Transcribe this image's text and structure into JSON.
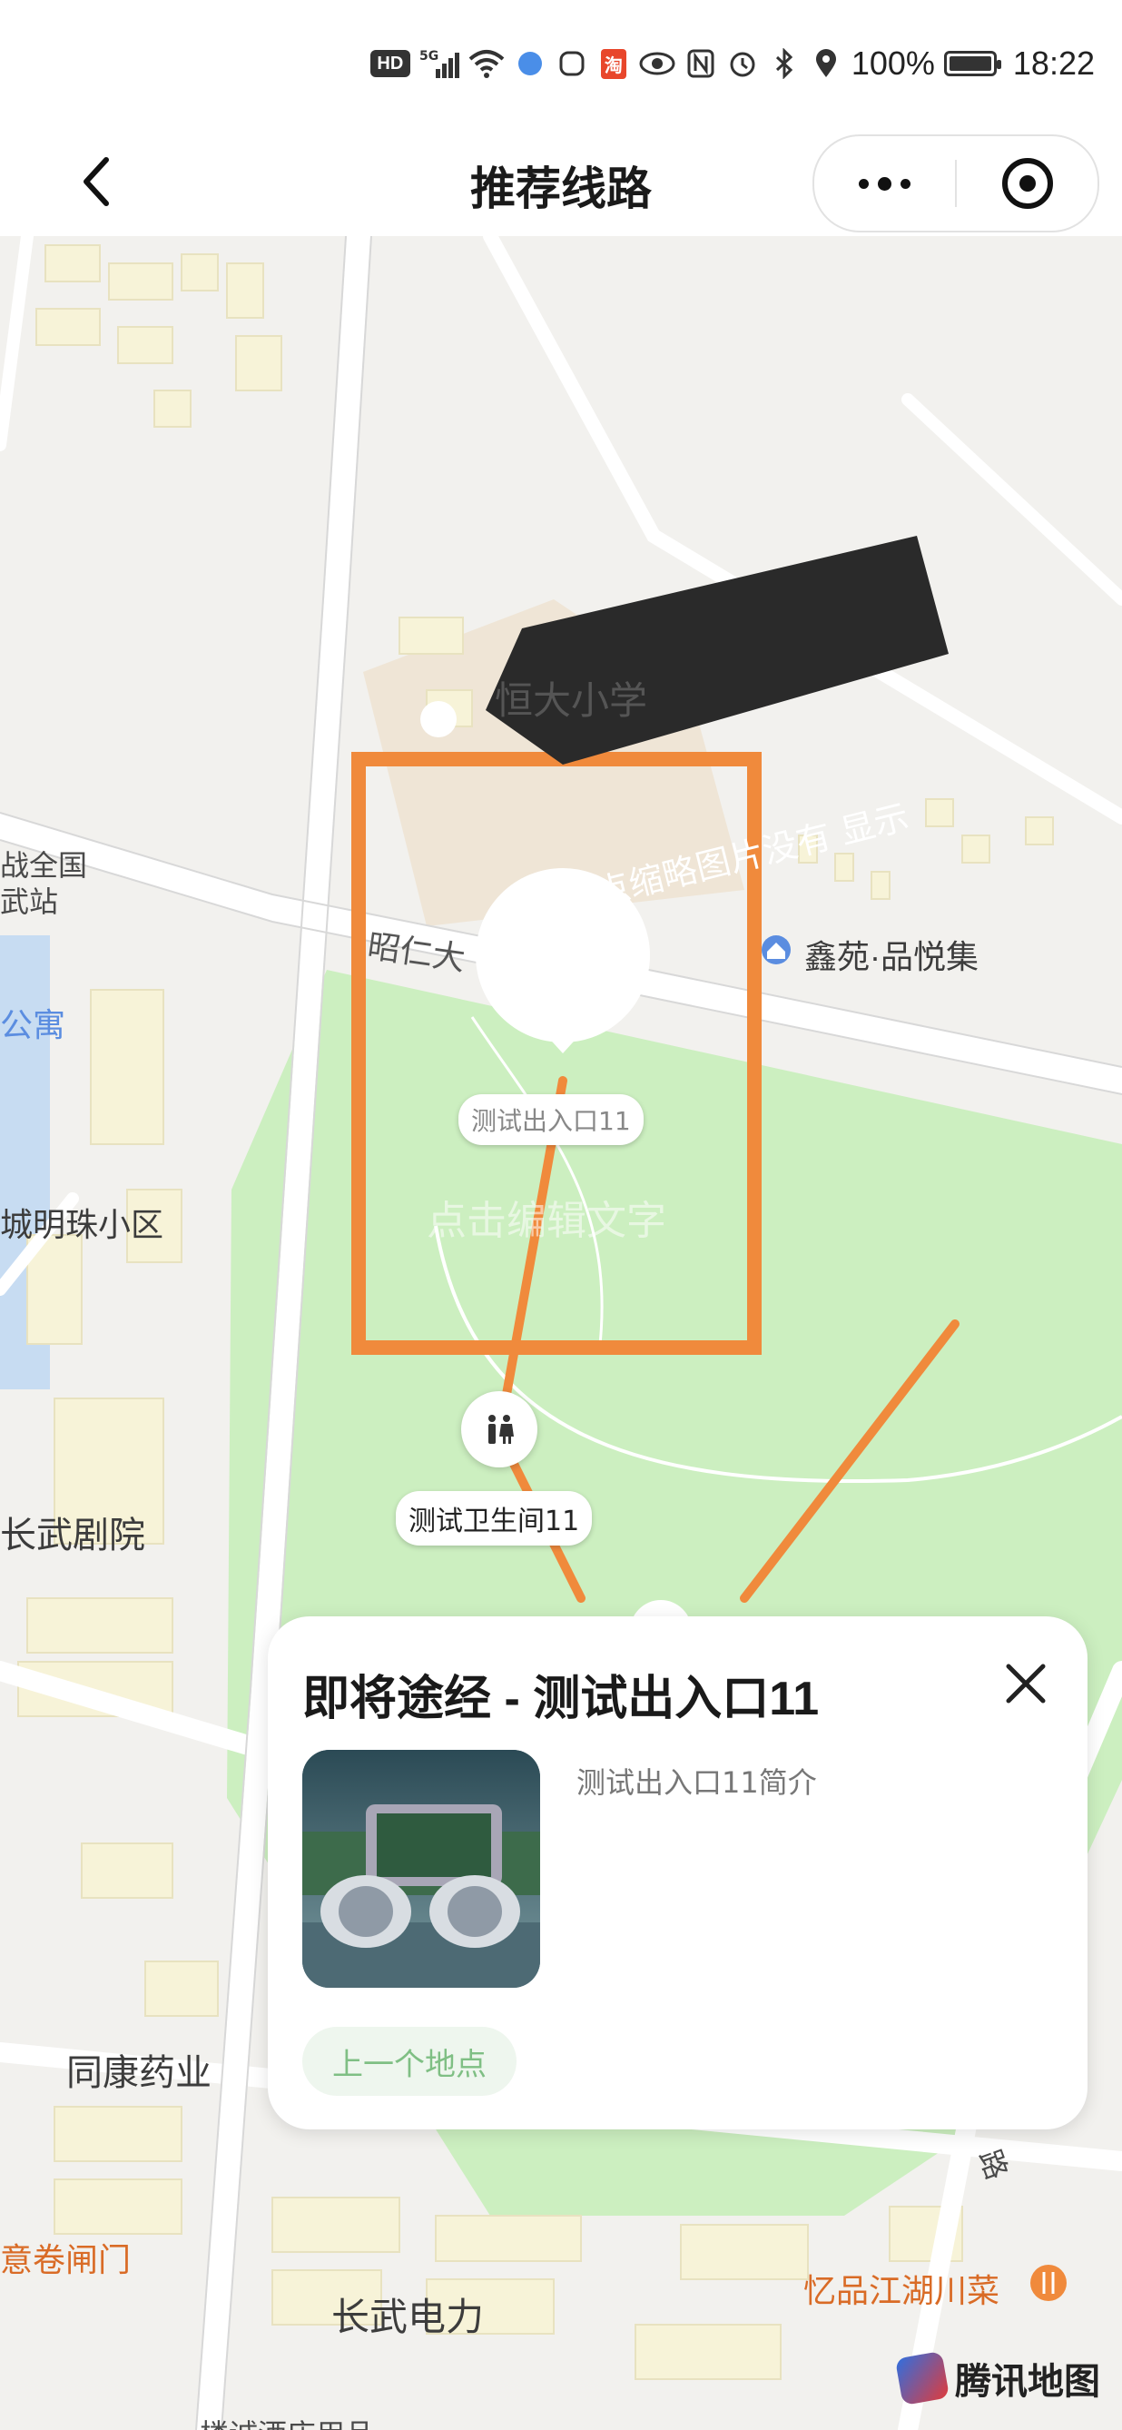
{
  "status_bar": {
    "hd": "HD",
    "signal": "5G",
    "taobao": "淘",
    "battery_text": "100%",
    "battery_level": 1.0,
    "time": "18:22"
  },
  "nav": {
    "title": "推荐线路"
  },
  "map": {
    "labels": {
      "school": "恒大小学",
      "road": "昭仁大",
      "xinyuan": "鑫苑·品悦集",
      "left1": "战全国",
      "left2": "武站",
      "left3": "公寓",
      "mingzhu": "城明珠小区",
      "theater": "长武剧院",
      "pharmacy": "同康药业",
      "juanzha": "意卷闸门",
      "power": "长武电力",
      "sichuan": "忆品江湖川菜",
      "road_right": "路",
      "bottom": "楼诚酒店用品"
    },
    "markers": {
      "entrance": "测试出入口11",
      "restroom": "测试卫生间11",
      "edit_hint": "点击编辑文字"
    },
    "annotation": "景点缩略图片没有 显示",
    "provider": "腾讯地图",
    "colors": {
      "route": "#f08a3c",
      "park": "#ccefc0",
      "highlight": "#f08a3c"
    }
  },
  "card": {
    "title": "即将途经 - 测试出入口11",
    "description": "测试出入口11简介",
    "prev_button": "上一个地点"
  }
}
